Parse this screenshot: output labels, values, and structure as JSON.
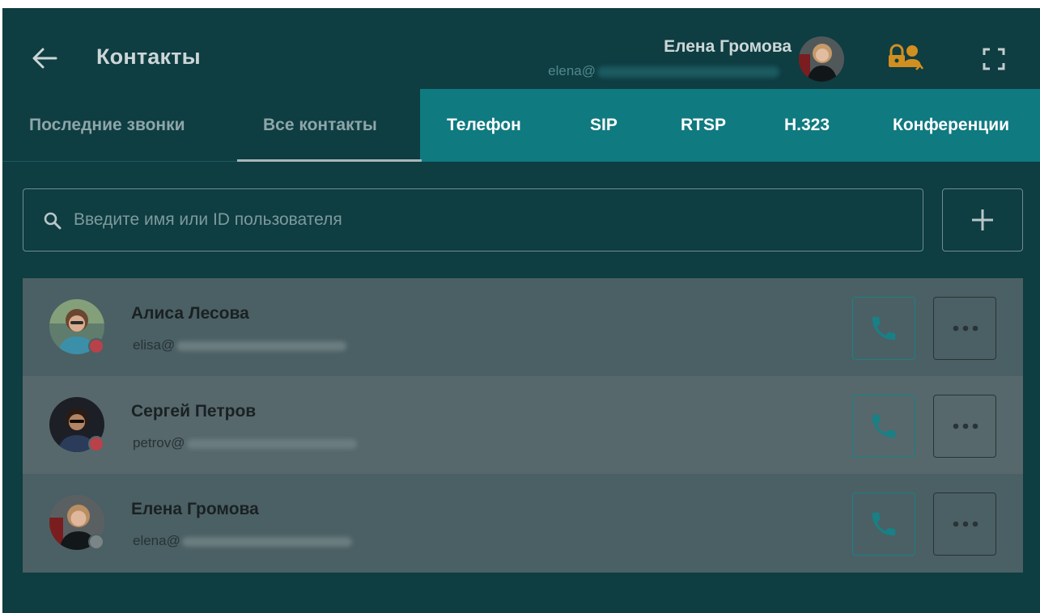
{
  "header": {
    "title": "Контакты",
    "user_name": "Елена Громова",
    "user_email": "elena@",
    "icons": [
      "back-arrow-icon",
      "lock-user-icon",
      "fullscreen-icon"
    ]
  },
  "tabs": [
    {
      "label": "Последние звонки",
      "active": false
    },
    {
      "label": "Все контакты",
      "active": true
    },
    {
      "label": "Телефон",
      "active": false
    },
    {
      "label": "SIP",
      "active": false
    },
    {
      "label": "RTSP",
      "active": false
    },
    {
      "label": "H.323",
      "active": false
    },
    {
      "label": "Конференции",
      "active": false
    }
  ],
  "search": {
    "placeholder": "Введите имя или ID пользователя"
  },
  "contacts": [
    {
      "name": "Алиса Лесова",
      "email": "elisa@",
      "status": "offline"
    },
    {
      "name": "Сергей Петров",
      "email": "petrov@",
      "status": "offline"
    },
    {
      "name": "Елена Громова",
      "email": "elena@",
      "status": "away"
    }
  ],
  "colors": {
    "background": "#0e3d42",
    "tab_highlight": "#0f7a80",
    "call_icon": "#178187",
    "status_offline": "#b9414a",
    "status_away": "#7b8486"
  }
}
